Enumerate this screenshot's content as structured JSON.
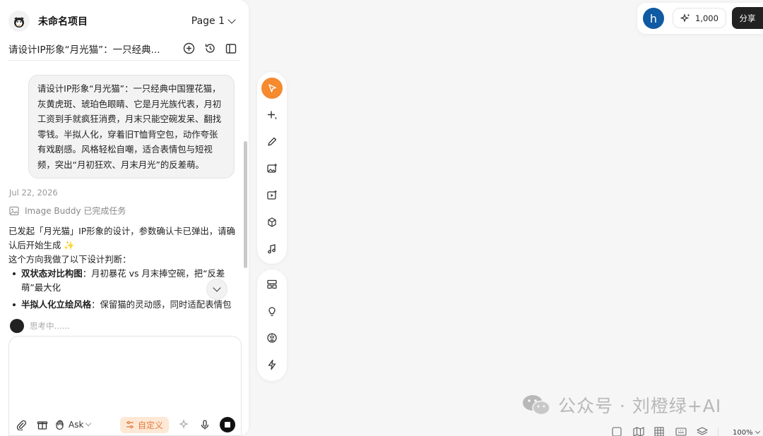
{
  "project": {
    "name": "未命名项目",
    "page_label": "Page 1"
  },
  "conversation": {
    "title": "请设计IP形象“月光猫”：一只经典..."
  },
  "user_message": "请设计IP形象“月光猫”：一只经典中国狸花猫，灰黄虎斑、琥珀色眼睛、它是月光族代表，月初工资到手就疯狂消费，月末只能空碗发呆、翻找零钱。半拟人化，穿着旧T恤背空包，动作夸张有戏剧感。风格轻松自嘲，适合表情包与短视频，突出“月初狂欢、月末月光”的反差萌。",
  "chat": {
    "date": "Jul 22, 2026",
    "task_status": "Image Buddy 已完成任务",
    "reply_intro": "已发起「月光猫」IP形象的设计，参数确认卡已弹出，请确认后开始生成 ✨",
    "reply_lead": "这个方向我做了以下设计判断：",
    "bullets": [
      {
        "title": "双状态对比构图",
        "text": "：月初暴花 vs 月末捧空碗，把“反差萌”最大化"
      },
      {
        "title": "半拟人化立绘风格",
        "text": "：保留猫的灵动感，同时适配表情包传播方式"
      }
    ],
    "thinking": "思考中......"
  },
  "input": {
    "placeholder": "",
    "mode_label": "Ask",
    "custom_label": "自定义"
  },
  "top_bar": {
    "avatar_letter": "h",
    "credits": "1,000",
    "share_label": "分享"
  },
  "watermark": {
    "dot_label": "公众号 · 刘橙绿+AI"
  },
  "canvas": {
    "zoom": "100%"
  },
  "colors": {
    "accent": "#f58a2e",
    "avatar": "#0f5aa3",
    "custom_bg": "#fde8d6"
  }
}
